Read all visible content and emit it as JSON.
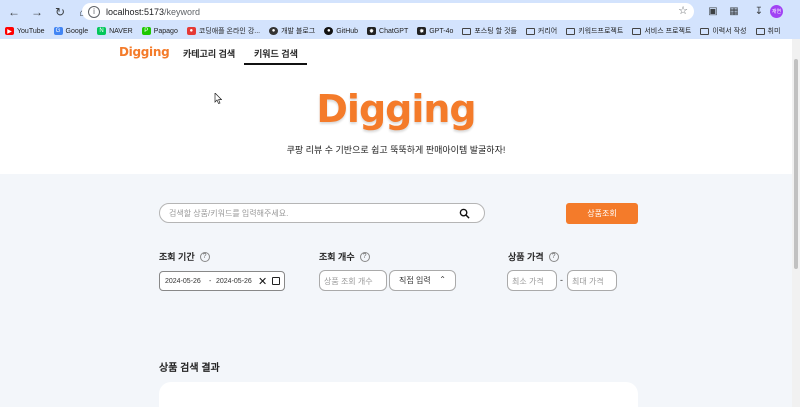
{
  "browser": {
    "url_host": "localhost:5173",
    "url_path": "/keyword",
    "profile_initials": "재연",
    "bookmarks": [
      "YouTube",
      "Google",
      "NAVER",
      "Papago",
      "코딩애플 온라인 강...",
      "개발 블로그",
      "GitHub",
      "ChatGPT",
      "GPT-4o",
      "포스팅 할 것들",
      "커리어",
      "키워드프로젝트",
      "서비스 프로젝트",
      "이력서 작성",
      "취미"
    ]
  },
  "header": {
    "brand": "Digging",
    "tabs": [
      {
        "label": "카테고리 검색",
        "active": false
      },
      {
        "label": "키워드 검색",
        "active": true
      }
    ]
  },
  "hero": {
    "title": "Digging",
    "tagline": "쿠팡 리뷰 수 기반으로 쉽고 뚝뚝하게 판매아이템 발굴하자!"
  },
  "search": {
    "placeholder": "검색할 상품/키워드를 입력해주세요.",
    "value": "",
    "button_label": "상품조회"
  },
  "filters": {
    "period": {
      "label": "조회 기간",
      "start": "2024-05-26",
      "separator": "-",
      "end": "2024-05-26"
    },
    "count": {
      "label": "조회 개수",
      "placeholder": "상품 조회 개수",
      "mode": "직접 입력"
    },
    "price": {
      "label": "상품 가격",
      "min_placeholder": "최소 가격",
      "dash": "-",
      "max_placeholder": "최대 가격"
    }
  },
  "results": {
    "title": "상품 검색 결과"
  },
  "colors": {
    "accent": "#f47b2a",
    "chrome": "#d3e3fd"
  }
}
